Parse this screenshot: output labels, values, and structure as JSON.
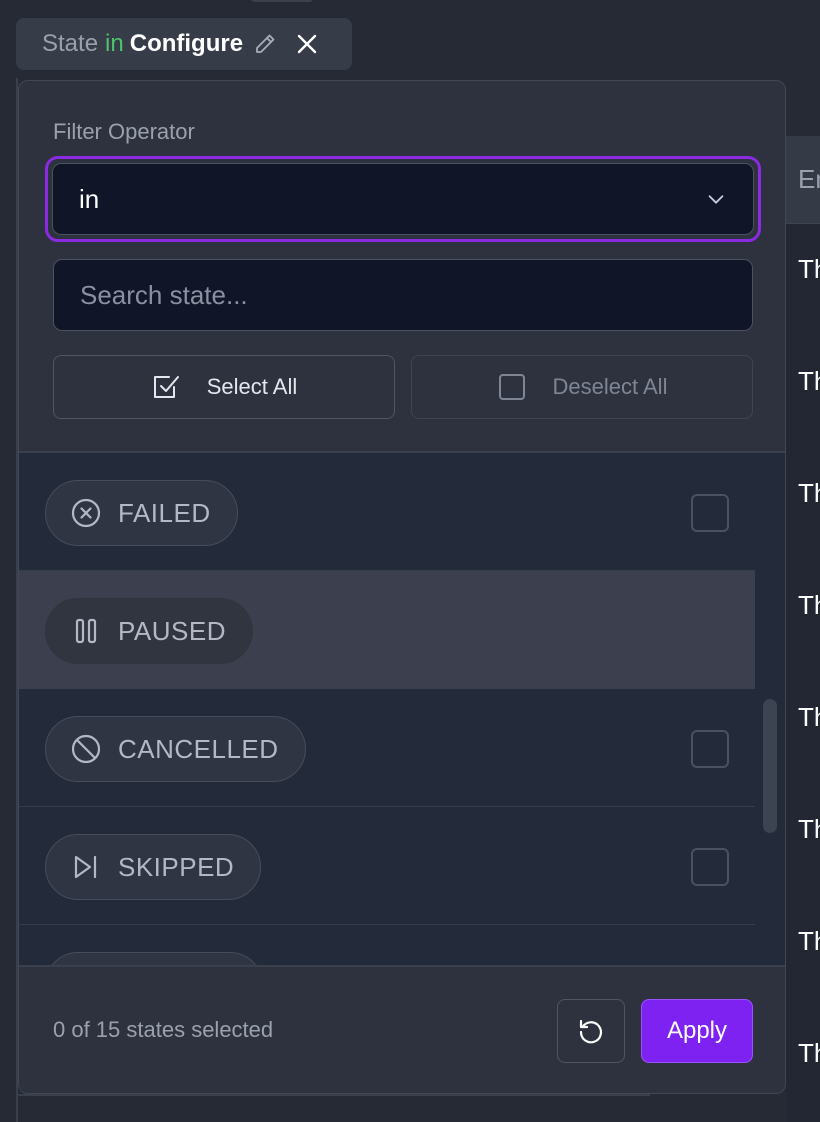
{
  "filter_chip": {
    "field": "State",
    "operator": "in",
    "value": "Configure"
  },
  "background_table": {
    "header_partial": "En",
    "cells_partial": [
      "Th",
      "Th",
      "Th",
      "Th",
      "Th",
      "Th",
      "Th",
      "Th"
    ]
  },
  "popover": {
    "operator_label": "Filter Operator",
    "operator_value": "in",
    "search_placeholder": "Search state...",
    "select_all_label": "Select All",
    "deselect_all_label": "Deselect All",
    "states": [
      {
        "label": "FAILED",
        "icon": "x-circle-icon",
        "checked": false
      },
      {
        "label": "PAUSED",
        "icon": "pause-icon",
        "checked": false,
        "hovered": true
      },
      {
        "label": "CANCELLED",
        "icon": "ban-icon",
        "checked": false
      },
      {
        "label": "SKIPPED",
        "icon": "skip-forward-icon",
        "checked": false
      }
    ],
    "selection_summary": "0 of 15 states selected",
    "apply_label": "Apply"
  },
  "colors": {
    "accent": "#7e22f2",
    "operator_green": "#4cc26a",
    "background": "#252a35",
    "panel": "#2d323e"
  }
}
